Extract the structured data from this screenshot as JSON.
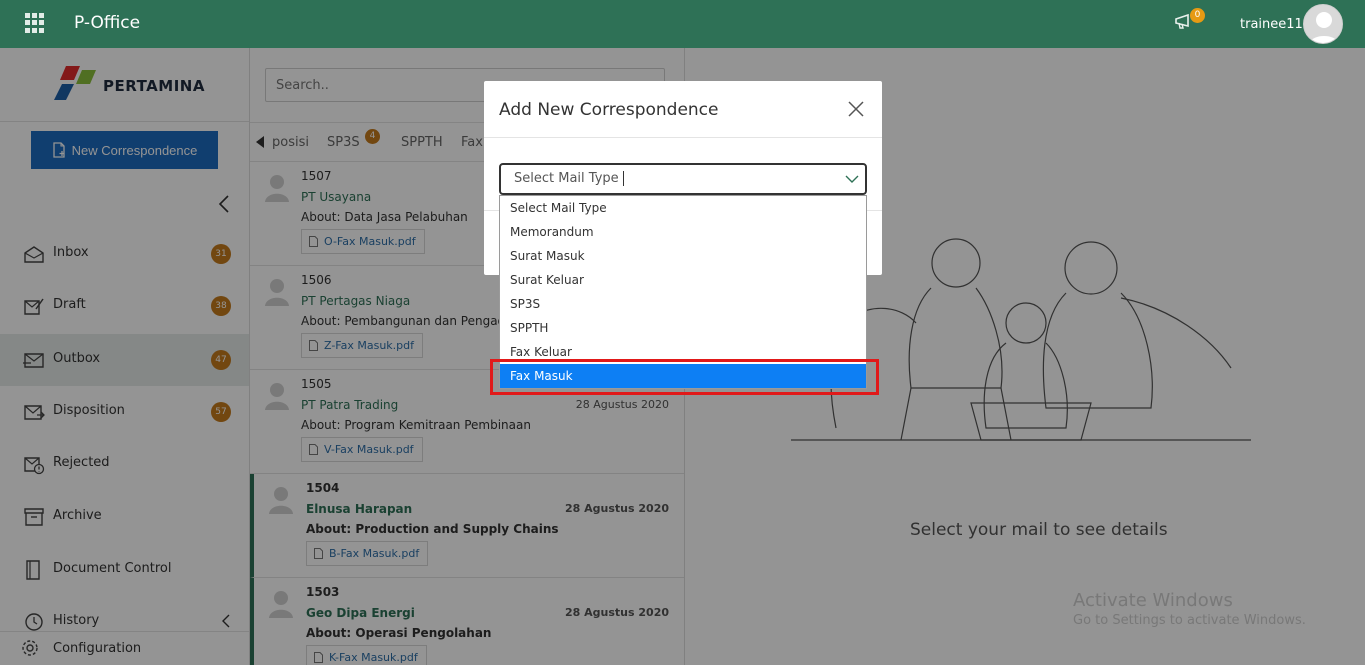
{
  "header": {
    "app_title": "P-Office",
    "notification_count": "0",
    "username": "trainee11",
    "icons": [
      "apps-grid-icon",
      "megaphone-icon",
      "user-avatar"
    ]
  },
  "sidebar": {
    "logo_text": "PERTAMINA",
    "new_button_label": "New Correspondence",
    "items": [
      {
        "label": "Inbox",
        "badge": "31",
        "icon": "inbox-icon"
      },
      {
        "label": "Draft",
        "badge": "38",
        "icon": "draft-icon"
      },
      {
        "label": "Outbox",
        "badge": "47",
        "icon": "outbox-icon"
      },
      {
        "label": "Disposition",
        "badge": "57",
        "icon": "disposition-icon"
      },
      {
        "label": "Rejected",
        "badge": "",
        "icon": "rejected-icon"
      },
      {
        "label": "Archive",
        "badge": "",
        "icon": "archive-icon"
      },
      {
        "label": "Document Control",
        "badge": "",
        "icon": "document-control-icon"
      },
      {
        "label": "History",
        "badge": "",
        "icon": "history-icon"
      }
    ],
    "configuration_label": "Configuration",
    "active_item": "Outbox"
  },
  "mail_list": {
    "search_placeholder": "Search..",
    "tabs": [
      {
        "label": "Disposisi",
        "visible_text": "posisi",
        "badge": ""
      },
      {
        "label": "SP3S",
        "visible_text": "SP3S",
        "badge": "4"
      },
      {
        "label": "SPPTH",
        "visible_text": "SPPTH",
        "badge": ""
      },
      {
        "label": "Fax",
        "visible_text": "Fax",
        "badge": ""
      }
    ],
    "items": [
      {
        "number": "1507",
        "sender": "PT Usayana",
        "about": "About: Data Jasa Pelabuhan",
        "date": "",
        "attachment": "O-Fax Masuk.pdf",
        "unread": false
      },
      {
        "number": "1506",
        "sender": "PT Pertagas Niaga",
        "about": "About: Pembangunan dan Pengadaan",
        "date": "",
        "attachment": "Z-Fax Masuk.pdf",
        "unread": false
      },
      {
        "number": "1505",
        "sender": "PT Patra Trading",
        "about": "About: Program Kemitraan Pembinaan",
        "date": "28 Agustus 2020",
        "attachment": "V-Fax Masuk.pdf",
        "unread": false
      },
      {
        "number": "1504",
        "sender": "Elnusa Harapan",
        "about": "About: Production and Supply Chains",
        "date": "28 Agustus 2020",
        "attachment": "B-Fax Masuk.pdf",
        "unread": true
      },
      {
        "number": "1503",
        "sender": "Geo Dipa Energi",
        "about": "About: Operasi Pengolahan",
        "date": "28 Agustus 2020",
        "attachment": "K-Fax Masuk.pdf",
        "unread": true
      }
    ]
  },
  "detail": {
    "empty_message": "Select your mail to see details",
    "watermark_line1": "Activate Windows",
    "watermark_line2": "Go to Settings to activate Windows."
  },
  "modal": {
    "title": "Add New Correspondence",
    "select_placeholder": "Select Mail Type",
    "options": [
      "Select Mail Type",
      "Memorandum",
      "Surat Masuk",
      "Surat Keluar",
      "SP3S",
      "SPPTH",
      "Fax Keluar",
      "Fax Masuk"
    ],
    "highlighted_option": "Fax Masuk"
  },
  "colors": {
    "header_green": "#2e7156",
    "primary_blue": "#1d6bbf",
    "badge_orange": "#c47a1c",
    "option_highlight": "#0d7ff4",
    "annotation_red": "#e11919"
  }
}
